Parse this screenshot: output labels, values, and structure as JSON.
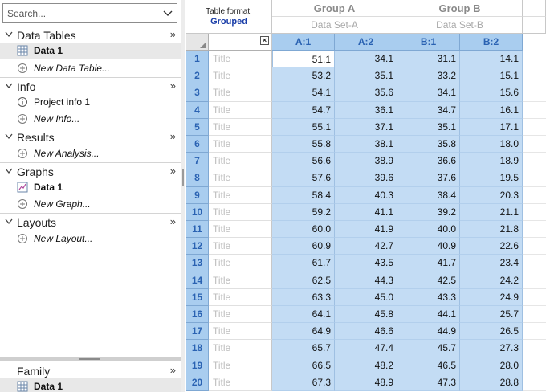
{
  "search": {
    "placeholder": "Search..."
  },
  "sections": {
    "data_tables": {
      "title": "Data Tables",
      "items": [
        {
          "label": "Data 1"
        },
        {
          "label": "New Data Table..."
        }
      ]
    },
    "info": {
      "title": "Info",
      "items": [
        {
          "label": "Project info 1"
        },
        {
          "label": "New Info..."
        }
      ]
    },
    "results": {
      "title": "Results",
      "items": [
        {
          "label": "New Analysis..."
        }
      ]
    },
    "graphs": {
      "title": "Graphs",
      "items": [
        {
          "label": "Data 1"
        },
        {
          "label": "New Graph..."
        }
      ]
    },
    "layouts": {
      "title": "Layouts",
      "items": [
        {
          "label": "New Layout..."
        }
      ]
    },
    "family": {
      "title": "Family",
      "items": [
        {
          "label": "Data 1"
        }
      ]
    },
    "collapse_glyph": "»"
  },
  "sheet": {
    "table_format_label": "Table format:",
    "table_format_value": "Grouped",
    "close_glyph": "×",
    "groups": [
      {
        "title": "Group A",
        "dataset": "Data Set-A",
        "columns": [
          "A:1",
          "A:2"
        ]
      },
      {
        "title": "Group B",
        "dataset": "Data Set-B",
        "columns": [
          "B:1",
          "B:2"
        ]
      }
    ],
    "title_placeholder": "Title",
    "rows": [
      {
        "n": "1",
        "v": [
          "51.1",
          "34.1",
          "31.1",
          "14.1"
        ]
      },
      {
        "n": "2",
        "v": [
          "53.2",
          "35.1",
          "33.2",
          "15.1"
        ]
      },
      {
        "n": "3",
        "v": [
          "54.1",
          "35.6",
          "34.1",
          "15.6"
        ]
      },
      {
        "n": "4",
        "v": [
          "54.7",
          "36.1",
          "34.7",
          "16.1"
        ]
      },
      {
        "n": "5",
        "v": [
          "55.1",
          "37.1",
          "35.1",
          "17.1"
        ]
      },
      {
        "n": "6",
        "v": [
          "55.8",
          "38.1",
          "35.8",
          "18.0"
        ]
      },
      {
        "n": "7",
        "v": [
          "56.6",
          "38.9",
          "36.6",
          "18.9"
        ]
      },
      {
        "n": "8",
        "v": [
          "57.6",
          "39.6",
          "37.6",
          "19.5"
        ]
      },
      {
        "n": "9",
        "v": [
          "58.4",
          "40.3",
          "38.4",
          "20.3"
        ]
      },
      {
        "n": "10",
        "v": [
          "59.2",
          "41.1",
          "39.2",
          "21.1"
        ]
      },
      {
        "n": "11",
        "v": [
          "60.0",
          "41.9",
          "40.0",
          "21.8"
        ]
      },
      {
        "n": "12",
        "v": [
          "60.9",
          "42.7",
          "40.9",
          "22.6"
        ]
      },
      {
        "n": "13",
        "v": [
          "61.7",
          "43.5",
          "41.7",
          "23.4"
        ]
      },
      {
        "n": "14",
        "v": [
          "62.5",
          "44.3",
          "42.5",
          "24.2"
        ]
      },
      {
        "n": "15",
        "v": [
          "63.3",
          "45.0",
          "43.3",
          "24.9"
        ]
      },
      {
        "n": "16",
        "v": [
          "64.1",
          "45.8",
          "44.1",
          "25.7"
        ]
      },
      {
        "n": "17",
        "v": [
          "64.9",
          "46.6",
          "44.9",
          "26.5"
        ]
      },
      {
        "n": "18",
        "v": [
          "65.7",
          "47.4",
          "45.7",
          "27.3"
        ]
      },
      {
        "n": "19",
        "v": [
          "66.5",
          "48.2",
          "46.5",
          "28.0"
        ]
      },
      {
        "n": "20",
        "v": [
          "67.3",
          "48.9",
          "47.3",
          "28.8"
        ]
      }
    ]
  },
  "colors": {
    "selection_fill": "#c3dcf4",
    "header_fill": "#a9cdef",
    "header_text": "#2a62b2",
    "format_value": "#1a3ea8"
  }
}
